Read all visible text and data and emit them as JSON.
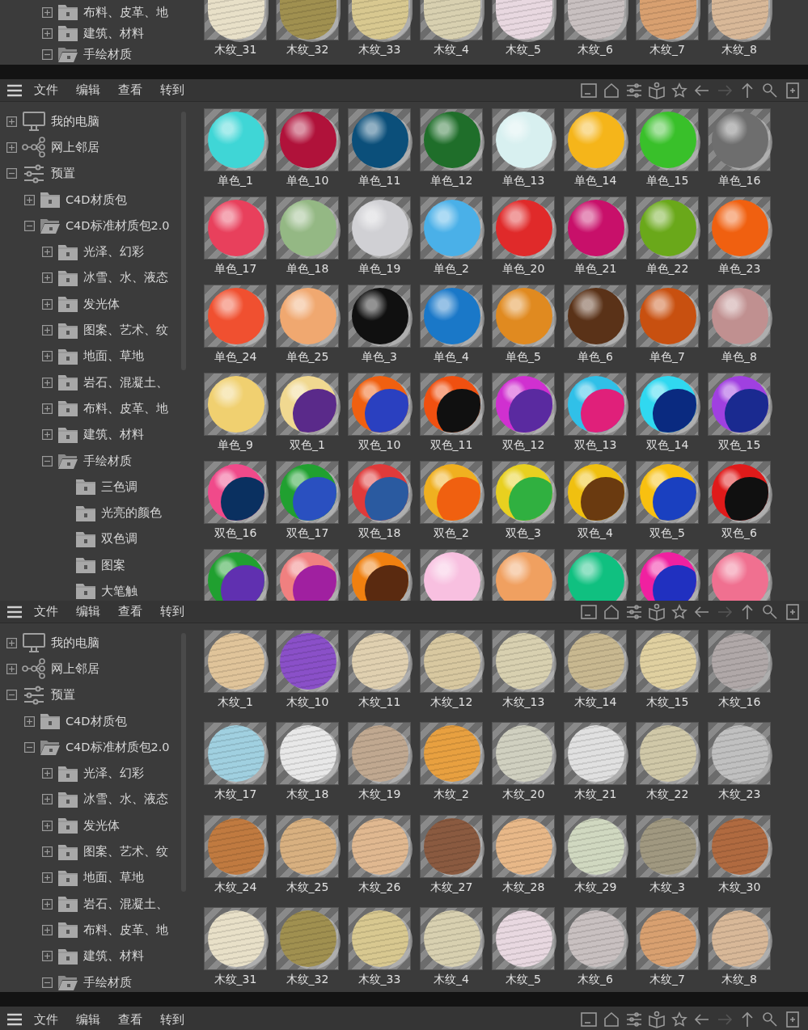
{
  "panels": [
    {
      "kind": "fragment",
      "tree": [
        {
          "children": [
            {
              "children": [
                {
                  "label": "布料、皮革、地",
                  "kind": "folder",
                  "expanded": false
                },
                {
                  "label": "建筑、材料",
                  "kind": "folder",
                  "expanded": false
                },
                {
                  "label": "手绘材质",
                  "kind": "folder",
                  "expanded": true
                }
              ]
            }
          ]
        }
      ],
      "materials": [
        {
          "label": "木纹_31",
          "kind": "wood",
          "color": "#e8e0c8"
        },
        {
          "label": "木纹_32",
          "kind": "wood",
          "color": "#a09050"
        },
        {
          "label": "木纹_33",
          "kind": "wood",
          "color": "#d8c890"
        },
        {
          "label": "木纹_4",
          "kind": "wood",
          "color": "#d8d0b0"
        },
        {
          "label": "木纹_5",
          "kind": "wood",
          "color": "#e8d8e0"
        },
        {
          "label": "木纹_6",
          "kind": "wood",
          "color": "#c8c0c0"
        },
        {
          "label": "木纹_7",
          "kind": "wood",
          "color": "#d8a070"
        },
        {
          "label": "木纹_8",
          "kind": "wood",
          "color": "#d8b898"
        }
      ]
    },
    {
      "kind": "browser",
      "menu": [
        "文件",
        "编辑",
        "查看",
        "转到"
      ],
      "tree": [
        {
          "label": "我的电脑",
          "kind": "computer",
          "expanded": false
        },
        {
          "label": "网上邻居",
          "kind": "network",
          "expanded": false
        },
        {
          "label": "预置",
          "kind": "presets",
          "expanded": true,
          "children": [
            {
              "label": "C4D材质包",
              "kind": "folder",
              "expanded": false
            },
            {
              "label": "C4D标准材质包2.0",
              "kind": "folder",
              "expanded": true,
              "children": [
                {
                  "label": "光泽、幻彩",
                  "kind": "folder",
                  "expanded": false
                },
                {
                  "label": "冰雪、水、液态",
                  "kind": "folder",
                  "expanded": false
                },
                {
                  "label": "发光体",
                  "kind": "folder",
                  "expanded": false
                },
                {
                  "label": "图案、艺术、纹",
                  "kind": "folder",
                  "expanded": false
                },
                {
                  "label": "地面、草地",
                  "kind": "folder",
                  "expanded": false
                },
                {
                  "label": "岩石、混凝土、",
                  "kind": "folder",
                  "expanded": false
                },
                {
                  "label": "布料、皮革、地",
                  "kind": "folder",
                  "expanded": false
                },
                {
                  "label": "建筑、材料",
                  "kind": "folder",
                  "expanded": false
                },
                {
                  "label": "手绘材质",
                  "kind": "folder",
                  "expanded": true,
                  "children": [
                    {
                      "label": "三色调",
                      "kind": "folder"
                    },
                    {
                      "label": "光亮的颜色",
                      "kind": "folder"
                    },
                    {
                      "label": "双色调",
                      "kind": "folder"
                    },
                    {
                      "label": "图案",
                      "kind": "folder"
                    },
                    {
                      "label": "大笔触",
                      "kind": "folder"
                    }
                  ]
                }
              ]
            }
          ]
        }
      ],
      "materials": [
        {
          "label": "单色_1",
          "kind": "solid",
          "color": "#3fd6d6"
        },
        {
          "label": "单色_10",
          "kind": "solid",
          "color": "#b0123a"
        },
        {
          "label": "单色_11",
          "kind": "solid",
          "color": "#0b4f7a"
        },
        {
          "label": "单色_12",
          "kind": "solid",
          "color": "#1f6e2a"
        },
        {
          "label": "单色_13",
          "kind": "solid",
          "color": "#d8f0f0"
        },
        {
          "label": "单色_14",
          "kind": "solid",
          "color": "#f5b51a"
        },
        {
          "label": "单色_15",
          "kind": "solid",
          "color": "#39c02a"
        },
        {
          "label": "单色_16",
          "kind": "solid",
          "color": "#6e6e6e"
        },
        {
          "label": "单色_17",
          "kind": "solid",
          "color": "#e8405c"
        },
        {
          "label": "单色_18",
          "kind": "solid",
          "color": "#94b884"
        },
        {
          "label": "单色_19",
          "kind": "solid",
          "color": "#d0d0d4"
        },
        {
          "label": "单色_2",
          "kind": "solid",
          "color": "#4ab0e8"
        },
        {
          "label": "单色_20",
          "kind": "solid",
          "color": "#e02a2a"
        },
        {
          "label": "单色_21",
          "kind": "solid",
          "color": "#c8106a"
        },
        {
          "label": "单色_22",
          "kind": "solid",
          "color": "#6aa81a"
        },
        {
          "label": "单色_23",
          "kind": "solid",
          "color": "#f06010"
        },
        {
          "label": "单色_24",
          "kind": "solid",
          "color": "#f05030"
        },
        {
          "label": "单色_25",
          "kind": "solid",
          "color": "#f0a870"
        },
        {
          "label": "单色_3",
          "kind": "solid",
          "color": "#101010"
        },
        {
          "label": "单色_4",
          "kind": "solid",
          "color": "#1a78c8"
        },
        {
          "label": "单色_5",
          "kind": "solid",
          "color": "#e08a20"
        },
        {
          "label": "单色_6",
          "kind": "solid",
          "color": "#5a3218"
        },
        {
          "label": "单色_7",
          "kind": "solid",
          "color": "#c85010"
        },
        {
          "label": "单色_8",
          "kind": "solid",
          "color": "#c09090"
        },
        {
          "label": "单色_9",
          "kind": "solid",
          "color": "#f0d070"
        },
        {
          "label": "双色_1",
          "kind": "dual",
          "color": "#f0d890",
          "shade": {
            "color": "#5a2a8a"
          }
        },
        {
          "label": "双色_10",
          "kind": "dual",
          "color": "#f06010",
          "shade": {
            "color": "#2a40c0"
          }
        },
        {
          "label": "双色_11",
          "kind": "dual",
          "color": "#f05010",
          "shade": {
            "color": "#101010"
          }
        },
        {
          "label": "双色_12",
          "kind": "dual",
          "color": "#d030d0",
          "shade": {
            "color": "#5a2aa0"
          }
        },
        {
          "label": "双色_13",
          "kind": "dual",
          "color": "#30c0e8",
          "shade": {
            "color": "#e0207a"
          }
        },
        {
          "label": "双色_14",
          "kind": "dual",
          "color": "#30d8f0",
          "shade": {
            "color": "#0a2a80"
          }
        },
        {
          "label": "双色_15",
          "kind": "dual",
          "color": "#a040e0",
          "shade": {
            "color": "#1a2a90"
          }
        },
        {
          "label": "双色_16",
          "kind": "dual",
          "color": "#f04a8a",
          "shade": {
            "color": "#0a3060"
          }
        },
        {
          "label": "双色_17",
          "kind": "dual",
          "color": "#20a030",
          "shade": {
            "color": "#2a50c0"
          }
        },
        {
          "label": "双色_18",
          "kind": "dual",
          "color": "#e03a3a",
          "shade": {
            "color": "#2a5aa0"
          }
        },
        {
          "label": "双色_2",
          "kind": "dual",
          "color": "#f0b020",
          "shade": {
            "color": "#f06010"
          }
        },
        {
          "label": "双色_3",
          "kind": "dual",
          "color": "#e8d020",
          "shade": {
            "color": "#30b040"
          }
        },
        {
          "label": "双色_4",
          "kind": "dual",
          "color": "#f0c010",
          "shade": {
            "color": "#6a3a10"
          }
        },
        {
          "label": "双色_5",
          "kind": "dual",
          "color": "#f8c010",
          "shade": {
            "color": "#1a40c0"
          }
        },
        {
          "label": "双色_6",
          "kind": "dual",
          "color": "#e01a1a",
          "shade": {
            "color": "#101010"
          }
        },
        {
          "kind": "dual",
          "color": "#20a030",
          "shade": {
            "color": "#6030b0"
          }
        },
        {
          "kind": "dual",
          "color": "#f08080",
          "shade": {
            "color": "#a020a0"
          }
        },
        {
          "kind": "dual",
          "color": "#f08010",
          "shade": {
            "color": "#5a2a10"
          }
        },
        {
          "kind": "solid",
          "color": "#f8c0e0"
        },
        {
          "kind": "solid",
          "color": "#f0a060"
        },
        {
          "kind": "solid",
          "color": "#10c080"
        },
        {
          "kind": "dual",
          "color": "#f020a0",
          "shade": {
            "color": "#2030c0"
          }
        },
        {
          "kind": "solid",
          "color": "#f07090"
        }
      ]
    },
    {
      "kind": "browser",
      "menu": [
        "文件",
        "编辑",
        "查看",
        "转到"
      ],
      "tree": [
        {
          "label": "我的电脑",
          "kind": "computer",
          "expanded": false
        },
        {
          "label": "网上邻居",
          "kind": "network",
          "expanded": false
        },
        {
          "label": "预置",
          "kind": "presets",
          "expanded": true,
          "children": [
            {
              "label": "C4D材质包",
              "kind": "folder",
              "expanded": false
            },
            {
              "label": "C4D标准材质包2.0",
              "kind": "folder",
              "expanded": true,
              "children": [
                {
                  "label": "光泽、幻彩",
                  "kind": "folder",
                  "expanded": false
                },
                {
                  "label": "冰雪、水、液态",
                  "kind": "folder",
                  "expanded": false
                },
                {
                  "label": "发光体",
                  "kind": "folder",
                  "expanded": false
                },
                {
                  "label": "图案、艺术、纹",
                  "kind": "folder",
                  "expanded": false
                },
                {
                  "label": "地面、草地",
                  "kind": "folder",
                  "expanded": false
                },
                {
                  "label": "岩石、混凝土、",
                  "kind": "folder",
                  "expanded": false
                },
                {
                  "label": "布料、皮革、地",
                  "kind": "folder",
                  "expanded": false
                },
                {
                  "label": "建筑、材料",
                  "kind": "folder",
                  "expanded": false
                },
                {
                  "label": "手绘材质",
                  "kind": "folder",
                  "expanded": true
                }
              ]
            }
          ]
        }
      ],
      "materials": [
        {
          "label": "木纹_1",
          "kind": "wood",
          "color": "#e0c49a"
        },
        {
          "label": "木纹_10",
          "kind": "wood",
          "color": "#8a50c8"
        },
        {
          "label": "木纹_11",
          "kind": "wood",
          "color": "#e0d0b0"
        },
        {
          "label": "木纹_12",
          "kind": "wood",
          "color": "#d8c8a0"
        },
        {
          "label": "木纹_13",
          "kind": "wood",
          "color": "#d8d0b0"
        },
        {
          "label": "木纹_14",
          "kind": "wood",
          "color": "#c8b890"
        },
        {
          "label": "木纹_15",
          "kind": "wood",
          "color": "#e0d0a0"
        },
        {
          "label": "木纹_16",
          "kind": "wood",
          "color": "#b0a8a8"
        },
        {
          "label": "木纹_17",
          "kind": "wood",
          "color": "#a0d0e0"
        },
        {
          "label": "木纹_18",
          "kind": "wood",
          "color": "#e8e8e8"
        },
        {
          "label": "木纹_19",
          "kind": "wood",
          "color": "#c0a890"
        },
        {
          "label": "木纹_2",
          "kind": "wood",
          "color": "#e8a040"
        },
        {
          "label": "木纹_20",
          "kind": "wood",
          "color": "#d0d0c0"
        },
        {
          "label": "木纹_21",
          "kind": "wood",
          "color": "#e0e0e0"
        },
        {
          "label": "木纹_22",
          "kind": "wood",
          "color": "#d0c8a8"
        },
        {
          "label": "木纹_23",
          "kind": "wood",
          "color": "#c0c0c0"
        },
        {
          "label": "木纹_24",
          "kind": "wood",
          "color": "#c07a40"
        },
        {
          "label": "木纹_25",
          "kind": "wood",
          "color": "#d8b080"
        },
        {
          "label": "木纹_26",
          "kind": "wood",
          "color": "#e0b890"
        },
        {
          "label": "木纹_27",
          "kind": "wood",
          "color": "#8a5a40"
        },
        {
          "label": "木纹_28",
          "kind": "wood",
          "color": "#e8b888"
        },
        {
          "label": "木纹_29",
          "kind": "wood",
          "color": "#d0d8c0"
        },
        {
          "label": "木纹_3",
          "kind": "wood",
          "color": "#a09880"
        },
        {
          "label": "木纹_30",
          "kind": "wood",
          "color": "#b06a40"
        },
        {
          "label": "木纹_31",
          "kind": "wood",
          "color": "#e8e0c8"
        },
        {
          "label": "木纹_32",
          "kind": "wood",
          "color": "#a09050"
        },
        {
          "label": "木纹_33",
          "kind": "wood",
          "color": "#d8c890"
        },
        {
          "label": "木纹_4",
          "kind": "wood",
          "color": "#d8d0b0"
        },
        {
          "label": "木纹_5",
          "kind": "wood",
          "color": "#e8d8e0"
        },
        {
          "label": "木纹_6",
          "kind": "wood",
          "color": "#c8c0c0"
        },
        {
          "label": "木纹_7",
          "kind": "wood",
          "color": "#d8a070"
        },
        {
          "label": "木纹_8",
          "kind": "wood",
          "color": "#d8b898"
        }
      ]
    },
    {
      "kind": "menu",
      "menu": [
        "文件",
        "编辑",
        "查看",
        "转到"
      ]
    }
  ]
}
